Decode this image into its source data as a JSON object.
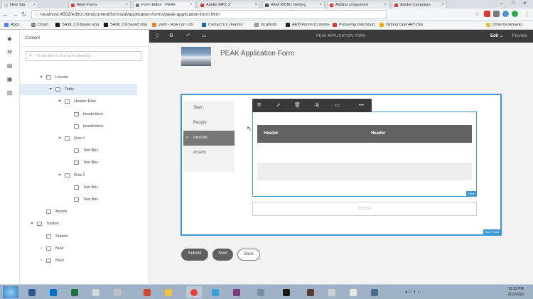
{
  "browser": {
    "tabs": [
      {
        "label": "New Tab",
        "fav_color": "#cccccc"
      },
      {
        "label": "AEM Forms",
        "fav_color": "#e03a2f"
      },
      {
        "label": "Form Editor : PEAK",
        "fav_color": "#7a7a7a"
      },
      {
        "label": "Adobe MPC 2",
        "fav_color": "#e03a2f"
      },
      {
        "label": "AEM WCM | Getting",
        "fav_color": "#4a4a4a"
      },
      {
        "label": "Adding component",
        "fav_color": "#e03a2f"
      },
      {
        "label": "Adobe Campaign",
        "fav_color": "#e03a2f"
      }
    ],
    "url": "localhost:4502/editor.html/content/forms/af/application-forms/peak-application-form.html",
    "bookmarks": [
      {
        "label": "Apps",
        "color": "#4285f4"
      },
      {
        "label": "Clavin",
        "color": "#888888"
      },
      {
        "label": "SAML 2.0 based sing",
        "color": "#1a1a1a"
      },
      {
        "label": "SAML 2.0 based sing",
        "color": "#1a1a1a"
      },
      {
        "label": "yaml - How can I do",
        "color": "#f48024"
      },
      {
        "label": "Contact Us | Fannie",
        "color": "#0b66b3"
      },
      {
        "label": "localhost",
        "color": "#999999"
      },
      {
        "label": "AEM Forms Custome",
        "color": "#222222"
      },
      {
        "label": "Preparing DataSourc",
        "color": "#e03a2f"
      },
      {
        "label": "Writing OpenAPI (Sw",
        "color": "#f0b400"
      },
      {
        "label": "Other bookmarks",
        "color": "#f0c040"
      }
    ]
  },
  "sidepanel": {
    "title": "Content",
    "filter_placeholder": "Enter title to find form object(s)",
    "tree": [
      {
        "label": "Income",
        "depth": 1,
        "twisty": "▾",
        "selected": false
      },
      {
        "label": "Table",
        "depth": 2,
        "twisty": "▾",
        "selected": true
      },
      {
        "label": "Header Row",
        "depth": 3,
        "twisty": "▾",
        "selected": false
      },
      {
        "label": "headerItem",
        "depth": 4,
        "twisty": "",
        "selected": false
      },
      {
        "label": "headerItem",
        "depth": 4,
        "twisty": "",
        "selected": false
      },
      {
        "label": "Row 1",
        "depth": 3,
        "twisty": "▾",
        "selected": false
      },
      {
        "label": "Text Box",
        "depth": 4,
        "twisty": "",
        "selected": false
      },
      {
        "label": "Text Box",
        "depth": 4,
        "twisty": "",
        "selected": false
      },
      {
        "label": "Row 2",
        "depth": 3,
        "twisty": "▾",
        "selected": false
      },
      {
        "label": "Text Box",
        "depth": 4,
        "twisty": "",
        "selected": false
      },
      {
        "label": "Text Box",
        "depth": 4,
        "twisty": "",
        "selected": false
      },
      {
        "label": "Assets",
        "depth": 1,
        "twisty": "",
        "selected": false
      },
      {
        "label": "Toolbar",
        "depth": 0,
        "twisty": "▾",
        "selected": false
      },
      {
        "label": "Submit",
        "depth": 1,
        "twisty": "",
        "selected": false
      },
      {
        "label": "Next",
        "depth": 1,
        "twisty": "›",
        "selected": false
      },
      {
        "label": "Back",
        "depth": 1,
        "twisty": "‹",
        "selected": false
      }
    ]
  },
  "toolbar": {
    "title": "PEAK APPLICATION FORM",
    "mode": "Edit",
    "preview": "Preview"
  },
  "form": {
    "title": "PEAK Application Form",
    "nav": [
      {
        "label": "Start",
        "active": false
      },
      {
        "label": "People",
        "active": false
      },
      {
        "label": "Income",
        "active": true
      },
      {
        "label": "Assets",
        "active": false
      }
    ],
    "table": {
      "headers": [
        "Header",
        "Header"
      ],
      "label": "Table"
    },
    "income_field_placeholder": "Income",
    "root_label": "Root Panel",
    "buttons": {
      "submit": "Submit",
      "next": "Next",
      "back": "Back"
    }
  },
  "taskbar": {
    "time": "12:23 PM",
    "date": "6/11/2018"
  },
  "colors": {
    "accent": "#3a98d4",
    "toolbar": "#3a3a3a",
    "button_dark": "#5f5f5f"
  }
}
